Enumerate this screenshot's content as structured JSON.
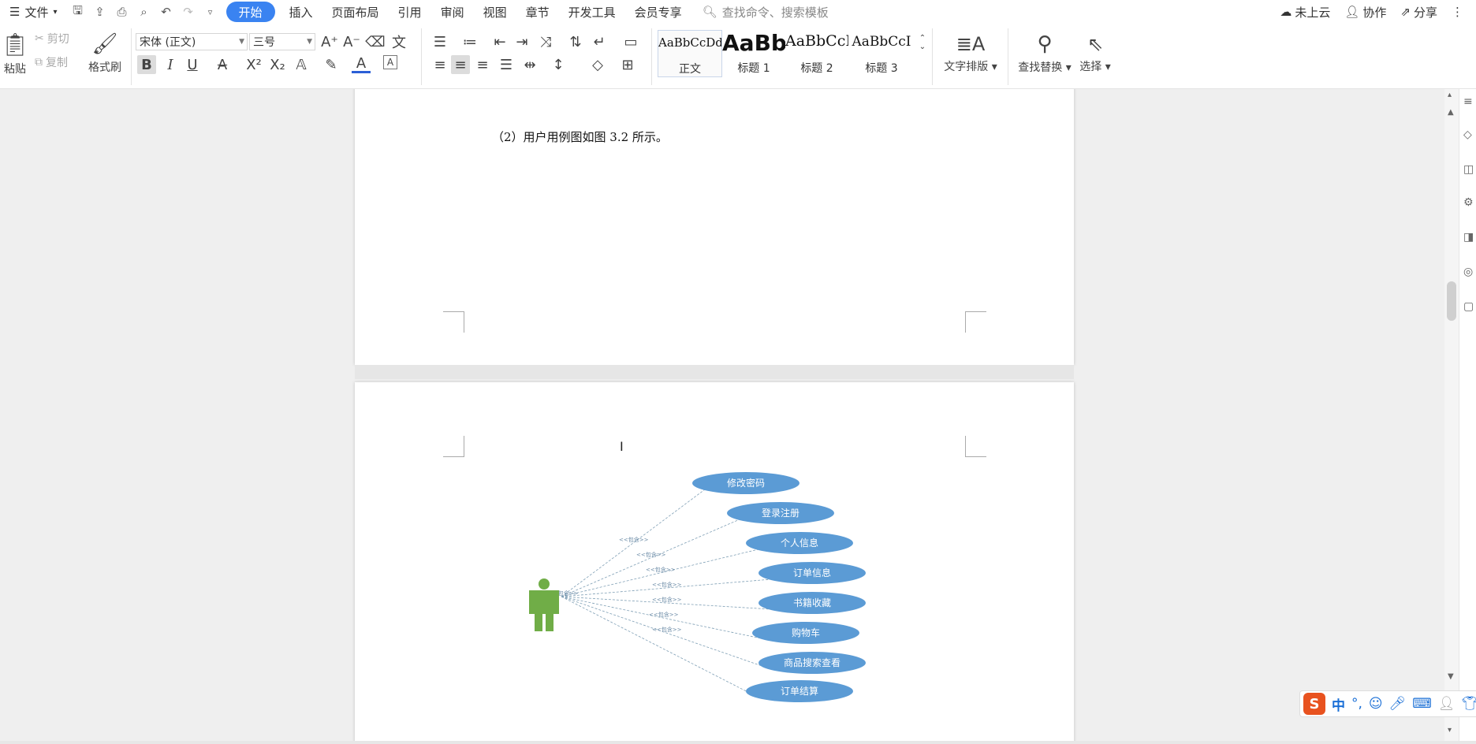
{
  "menubar": {
    "file": "文件",
    "tabs": [
      "开始",
      "插入",
      "页面布局",
      "引用",
      "审阅",
      "视图",
      "章节",
      "开发工具",
      "会员专享"
    ],
    "active_tab": "开始",
    "search_placeholder": "查找命令、搜索模板",
    "cloud": "未上云",
    "collab": "协作",
    "share": "分享"
  },
  "ribbon": {
    "paste": "粘贴",
    "cut": "剪切",
    "copy": "复制",
    "format_painter": "格式刷",
    "font": "宋体 (正文)",
    "size": "三号",
    "bold": "B",
    "italic": "I",
    "underline": "U",
    "styles": [
      {
        "preview": "AaBbCcDd",
        "name": "正文"
      },
      {
        "preview": "AaBb",
        "name": "标题 1"
      },
      {
        "preview": "AaBbCcI",
        "name": "标题 2"
      },
      {
        "preview": "AaBbCcI",
        "name": "标题 3"
      }
    ],
    "text_layout": "文字排版",
    "find_replace": "查找替换",
    "select": "选择"
  },
  "document": {
    "paragraph": "（2）用户用例图如图 3.2 所示。",
    "diagram": {
      "use_cases": [
        "修改密码",
        "登录注册",
        "个人信息",
        "订单信息",
        "书籍收藏",
        "购物车",
        "商品搜索查看",
        "订单结算"
      ],
      "relation_label": "<<包含>>"
    }
  },
  "colors": {
    "accent": "#3a83f1",
    "usecase_fill": "#5b9bd5",
    "actor": "#70ad47"
  },
  "ime": {
    "lang": "中",
    "punct": "°,"
  }
}
